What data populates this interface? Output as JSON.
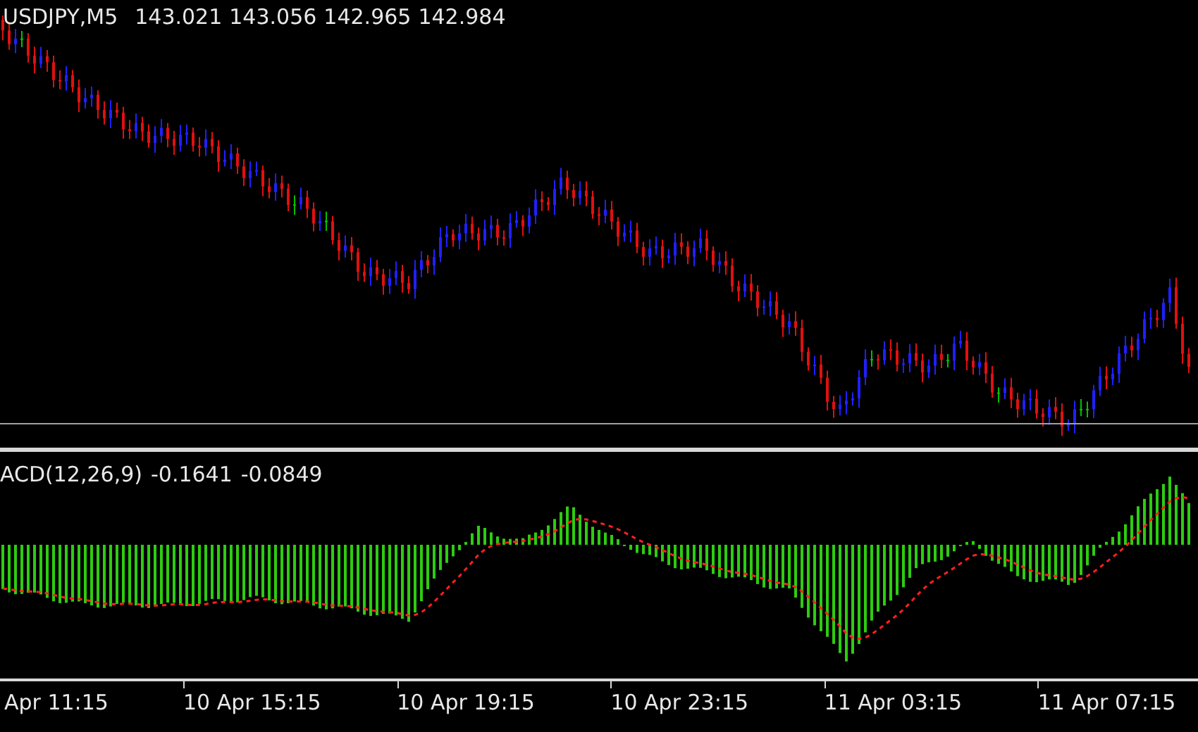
{
  "main_chart": {
    "symbol": "USDJPY,M5",
    "ohlc": [
      "143.021",
      "143.056",
      "142.965",
      "142.984"
    ]
  },
  "indicator": {
    "label": "ACD(12,26,9)",
    "values": [
      "-0.1641",
      "-0.0849"
    ]
  },
  "time_axis": {
    "labels": [
      "Apr 11:15",
      "10 Apr 15:15",
      "10 Apr 19:15",
      "10 Apr 23:15",
      "11 Apr 03:15",
      "11 Apr 07:15"
    ]
  }
}
